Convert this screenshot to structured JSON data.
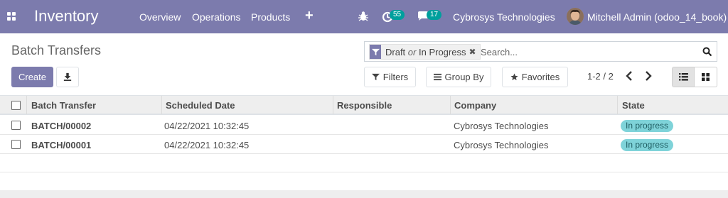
{
  "navbar": {
    "apps_icon": "apps-grid-icon",
    "app_name": "Inventory",
    "menu": [
      {
        "label": "Overview"
      },
      {
        "label": "Operations"
      },
      {
        "label": "Products"
      }
    ],
    "add_icon": "+",
    "activities_count": "55",
    "messages_count": "17",
    "company": "Cybrosys Technologies",
    "user": "Mitchell Admin (odoo_14_book)",
    "bg_color": "#7c7bad",
    "badge_color": "#00a09d"
  },
  "control_panel": {
    "title": "Batch Transfers",
    "create_label": "Create",
    "search": {
      "facet_part1": "Draft",
      "facet_or": "or",
      "facet_part2": "In Progress",
      "facet_close": "✖",
      "placeholder": "Search..."
    },
    "filters_label": "Filters",
    "groupby_label": "Group By",
    "favorites_label": "Favorites",
    "pager": "1-2 / 2"
  },
  "table": {
    "columns": [
      "Batch Transfer",
      "Scheduled Date",
      "Responsible",
      "Company",
      "State"
    ],
    "rows": [
      {
        "name": "BATCH/00002",
        "date": "04/22/2021 10:32:45",
        "responsible": "",
        "company": "Cybrosys Technologies",
        "state": "In progress"
      },
      {
        "name": "BATCH/00001",
        "date": "04/22/2021 10:32:45",
        "responsible": "",
        "company": "Cybrosys Technologies",
        "state": "In progress"
      }
    ],
    "state_color": "#7fd3d9"
  }
}
